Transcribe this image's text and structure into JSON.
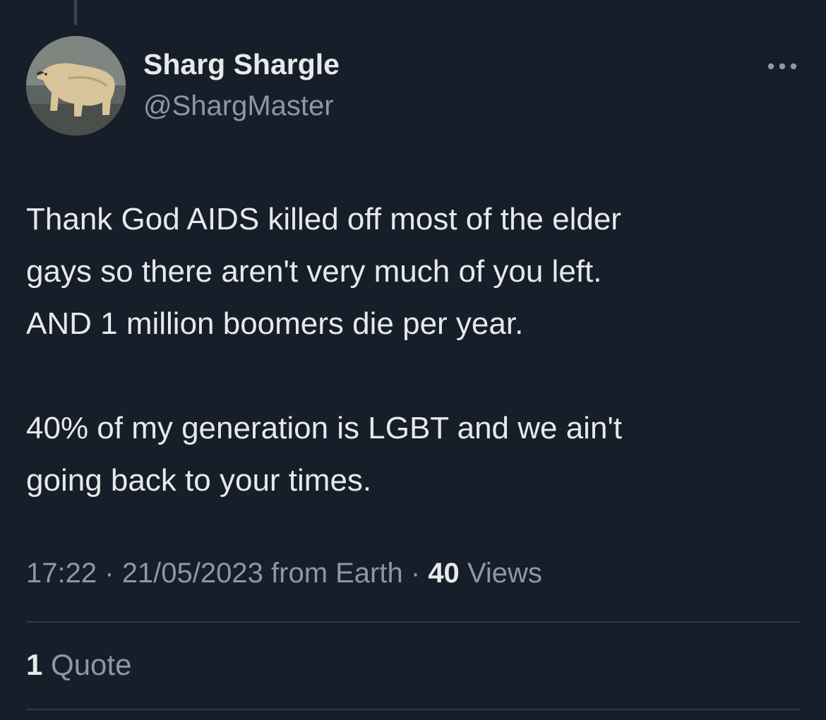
{
  "tweet": {
    "author": {
      "display_name": "Sharg Shargle",
      "handle": "@ShargMaster",
      "avatar_icon": "polar-bear-avatar"
    },
    "more_icon": "more-horizontal-icon",
    "text_lines_paragraph_1": [
      "Thank God AIDS killed off most of the elder",
      "gays so there aren't very much of you left.",
      "AND 1 million boomers die per year."
    ],
    "text_lines_paragraph_2": [
      "40% of my generation is LGBT and we ain't",
      "going back to your times."
    ],
    "time": "17:22",
    "separator": "·",
    "date": "21/05/2023",
    "source": "from Earth",
    "views_count": "40",
    "views_label": "Views",
    "quotes_count": "1",
    "quotes_label": "Quote"
  },
  "colors": {
    "background": "#161e29",
    "primary_text": "#e7e9ea",
    "secondary_text": "#8b98a5",
    "divider": "#2f3b45"
  }
}
